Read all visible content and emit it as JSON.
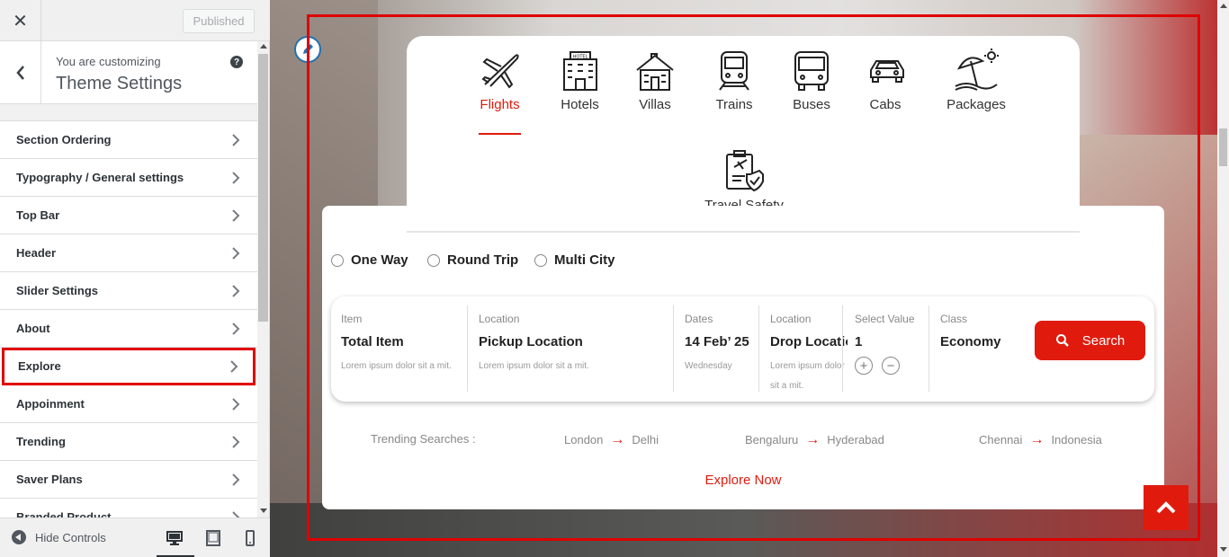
{
  "customizer": {
    "published_label": "Published",
    "customizing_text": "You are customizing",
    "section_title": "Theme Settings",
    "items": [
      {
        "label": "Section Ordering"
      },
      {
        "label": "Typography / General settings"
      },
      {
        "label": "Top Bar"
      },
      {
        "label": "Header"
      },
      {
        "label": "Slider Settings"
      },
      {
        "label": "About"
      },
      {
        "label": "Explore",
        "active": true
      },
      {
        "label": "Appoinment"
      },
      {
        "label": "Trending"
      },
      {
        "label": "Saver Plans"
      },
      {
        "label": "Branded Product"
      }
    ],
    "hide_controls": "Hide Controls"
  },
  "booking": {
    "tabs": [
      {
        "label": "Flights",
        "icon": "plane-icon",
        "active": true
      },
      {
        "label": "Hotels",
        "icon": "hotel-icon"
      },
      {
        "label": "Villas",
        "icon": "villa-icon"
      },
      {
        "label": "Trains",
        "icon": "train-icon"
      },
      {
        "label": "Buses",
        "icon": "bus-icon"
      },
      {
        "label": "Cabs",
        "icon": "cab-icon"
      },
      {
        "label": "Packages",
        "icon": "beach-icon"
      },
      {
        "label": "Travel Safety",
        "icon": "safety-icon"
      }
    ],
    "trip_types": [
      "One Way",
      "Round Trip",
      "Multi City"
    ],
    "fields": [
      {
        "label": "Item",
        "value": "Total Item",
        "sub": "Lorem ipsum dolor sit a mit."
      },
      {
        "label": "Location",
        "value": "Pickup Location",
        "sub": "Lorem ipsum dolor sit a mit."
      },
      {
        "label": "Dates",
        "value": "14 Feb’ 25",
        "sub": "Wednesday"
      },
      {
        "label": "Location",
        "value": "Drop Location",
        "sub": "Lorem ipsum dolor sit a mit."
      },
      {
        "label": "Select Value",
        "value": "1"
      },
      {
        "label": "Class",
        "value": "Economy"
      }
    ],
    "search_label": "Search",
    "trending_label": "Trending Searches :",
    "trending": [
      {
        "from": "London",
        "to": "Delhi"
      },
      {
        "from": "Bengaluru",
        "to": "Hyderabad"
      },
      {
        "from": "Chennai",
        "to": "Indonesia"
      }
    ],
    "explore_label": "Explore Now",
    "accent_color": "#e01b0e"
  }
}
